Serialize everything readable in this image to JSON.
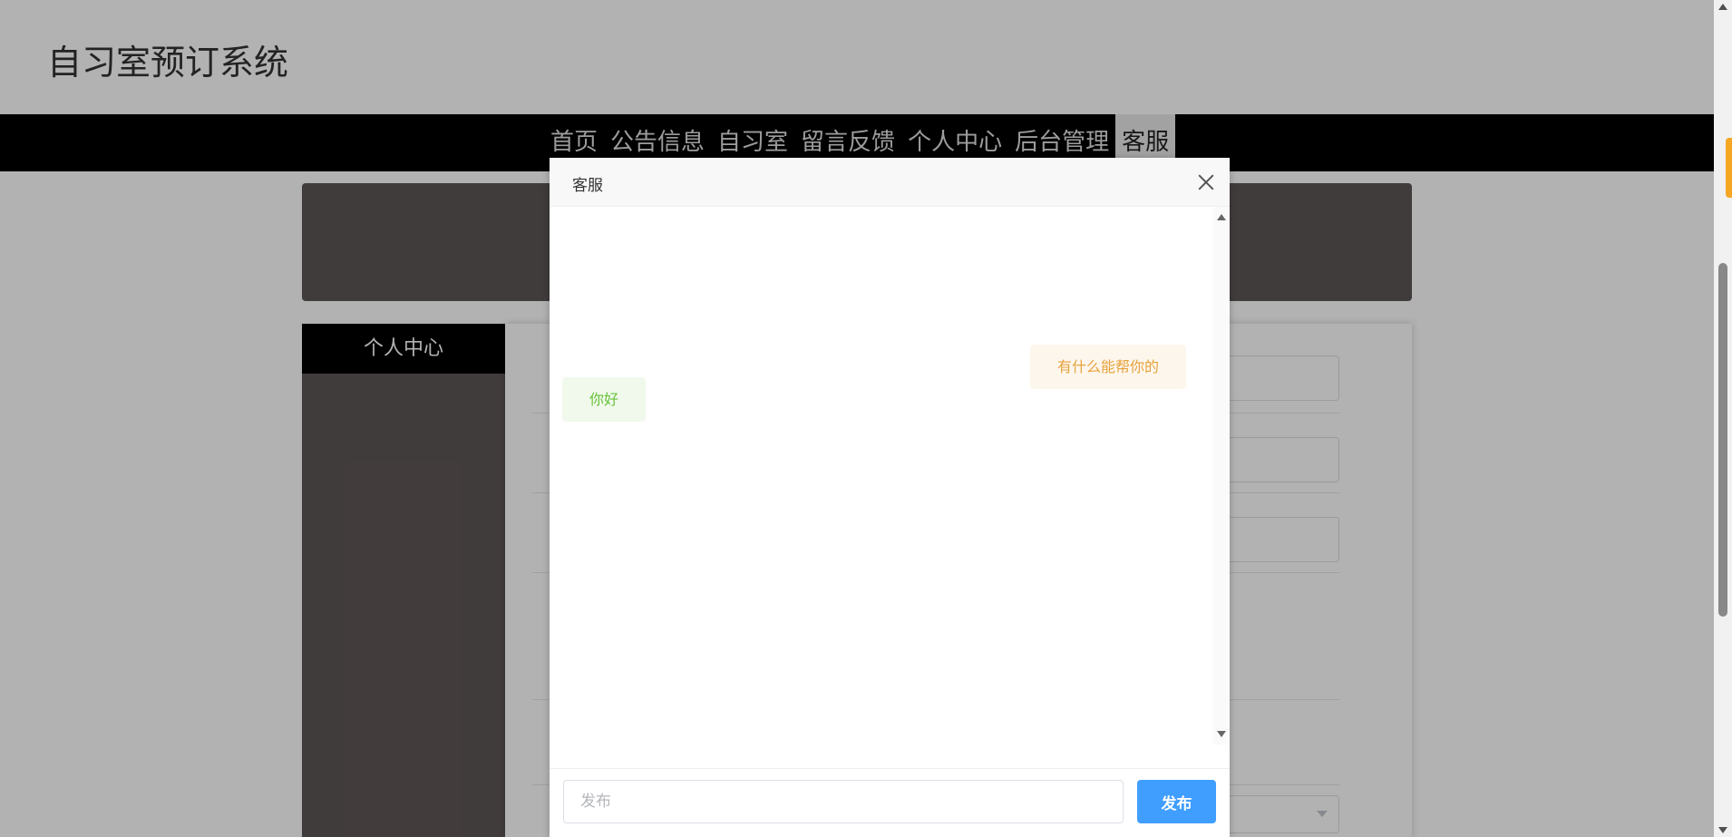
{
  "site": {
    "title": "自习室预订系统"
  },
  "nav": {
    "items": [
      {
        "label": "首页"
      },
      {
        "label": "公告信息"
      },
      {
        "label": "自习室"
      },
      {
        "label": "留言反馈"
      },
      {
        "label": "个人中心"
      },
      {
        "label": "后台管理"
      },
      {
        "label": "客服"
      }
    ],
    "active": "客服"
  },
  "sidebar": {
    "title": "个人中心"
  },
  "chat_dialog": {
    "title": "客服",
    "messages": [
      {
        "text": "有什么能帮你的",
        "side": "right"
      },
      {
        "text": "你好",
        "side": "left"
      }
    ],
    "input": {
      "value": "",
      "placeholder": "发布"
    },
    "send_label": "发布"
  },
  "colors": {
    "nav_bg": "#000000",
    "primary": "#409eff",
    "left_bubble_bg": "#f0f9eb",
    "left_bubble_text": "#67c23a",
    "right_bubble_bg": "#fdf6ec",
    "right_bubble_text": "#e6a23c",
    "panel": "#5e5756"
  }
}
